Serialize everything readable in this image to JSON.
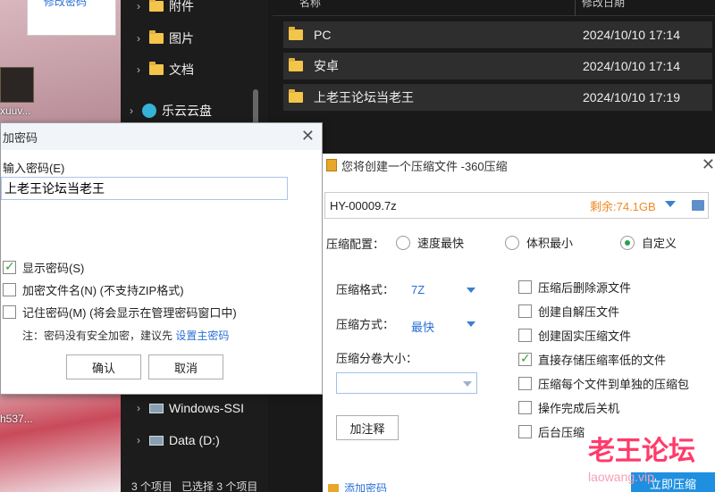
{
  "desktop": {
    "top_note": "修改密码",
    "labels": [
      "xuuv...",
      "h537..."
    ]
  },
  "explorer": {
    "nav": [
      {
        "label": "附件",
        "icon": "folder-icon"
      },
      {
        "label": "图片",
        "icon": "folder-icon"
      },
      {
        "label": "文档",
        "icon": "folder-icon"
      },
      {
        "label": "乐云云盘",
        "icon": "cloud-icon"
      },
      {
        "label": "Windows-SSI",
        "icon": "drive-icon"
      },
      {
        "label": "Data (D:)",
        "icon": "drive-icon"
      }
    ],
    "columns": {
      "name": "名称",
      "date": "修改日期"
    },
    "files": [
      {
        "name": "PC",
        "date": "2024/10/10 17:14"
      },
      {
        "name": "安卓",
        "date": "2024/10/10 17:14"
      },
      {
        "name": "上老王论坛当老王",
        "date": "2024/10/10 17:19"
      }
    ],
    "status": {
      "count": "3 个项目",
      "selected": "已选择 3 个项目"
    }
  },
  "password_dialog": {
    "title": "加密码",
    "input_label": "输入密码(E)",
    "password_value": "上老王论坛当老王",
    "show_password": {
      "label": "显示密码(S)",
      "checked": true
    },
    "encrypt_names": {
      "label": "加密文件名(N) (不支持ZIP格式)",
      "checked": false
    },
    "remember": {
      "label": "记住密码(M) (将会显示在管理密码窗口中)",
      "checked": false
    },
    "note_prefix": "注：密码没有安全加密，建议先",
    "note_link": "设置主密码",
    "ok": "确认",
    "cancel": "取消"
  },
  "zip_dialog": {
    "title": "您将创建一个压缩文件 -360压缩",
    "filename": "HY-00009.7z",
    "free_space": "剩余:74.1GB",
    "config_label": "压缩配置：",
    "options": [
      {
        "label": "速度最快",
        "selected": false
      },
      {
        "label": "体积最小",
        "selected": false
      },
      {
        "label": "自定义",
        "selected": true
      }
    ],
    "format_label": "压缩格式：",
    "format_value": "7Z",
    "method_label": "压缩方式：",
    "method_value": "最快",
    "split_label": "压缩分卷大小：",
    "comment_button": "加注释",
    "checks": [
      {
        "label": "压缩后删除源文件",
        "checked": false
      },
      {
        "label": "创建自解压文件",
        "checked": false
      },
      {
        "label": "创建固实压缩文件",
        "checked": false
      },
      {
        "label": "直接存储压缩率低的文件",
        "checked": true
      },
      {
        "label": "压缩每个文件到单独的压缩包",
        "checked": false
      },
      {
        "label": "操作完成后关机",
        "checked": false
      },
      {
        "label": "后台压缩",
        "checked": false
      }
    ],
    "add_password": "添加密码",
    "start_button": "立即压缩"
  },
  "watermark": {
    "cn": "老王论坛",
    "en": "laowang.vip"
  }
}
